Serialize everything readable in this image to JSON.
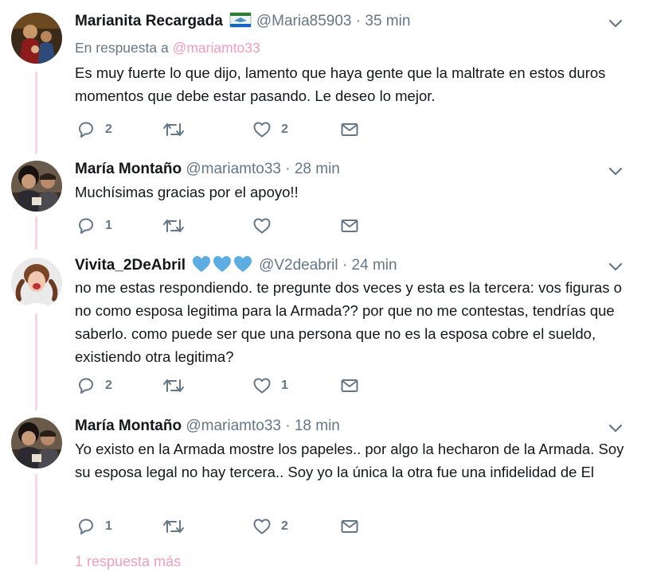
{
  "tweets": [
    {
      "name": "Marianita Recargada",
      "handle": "@Maria85903",
      "separator": "·",
      "time": "35 min",
      "reply_prefix": "En respuesta a",
      "reply_to": "@mariamto33",
      "text": "Es muy fuerte lo que dijo, lamento que haya gente que la maltrate en estos duros momentos que debe estar pasando. Le deseo lo mejor.",
      "replies": "2",
      "retweets": "",
      "likes": "2"
    },
    {
      "name": "María Montaño",
      "handle": "@mariamto33",
      "separator": "·",
      "time": "28 min",
      "text": "Muchísimas gracias por el apoyo!!",
      "replies": "1",
      "retweets": "",
      "likes": ""
    },
    {
      "name": "Vivita_2DeAbril",
      "handle": "@V2deabril",
      "separator": "·",
      "time": "24 min",
      "text": "no me estas respondiendo. te pregunte dos veces y esta es la tercera: vos figuras o no como esposa legitima para la Armada?? por que no me contestas, tendrías que saberlo. como puede ser que una persona que no es la esposa cobre el sueldo, existiendo otra legitima?",
      "replies": "2",
      "retweets": "",
      "likes": "1"
    },
    {
      "name": "María Montaño",
      "handle": "@mariamto33",
      "separator": "·",
      "time": "18 min",
      "text": "Yo existo en la Armada mostre los papeles.. por algo la hecharon de la Armada. Soy su esposa legal no hay tercera.. Soy yo la única la otra fue una infidelidad de El",
      "replies": "1",
      "retweets": "",
      "likes": "2"
    }
  ],
  "more_replies": "1 respuesta más",
  "colors": {
    "thread_line": "#fbd5e3",
    "link_pink": "#f29cbb",
    "muted": "#657786",
    "heart_emoji": "#5dade2"
  },
  "icons": [
    "reply-icon",
    "retweet-icon",
    "like-icon",
    "message-icon",
    "chevron-down-icon",
    "flag-emoji-icon",
    "blue-heart-icon"
  ]
}
